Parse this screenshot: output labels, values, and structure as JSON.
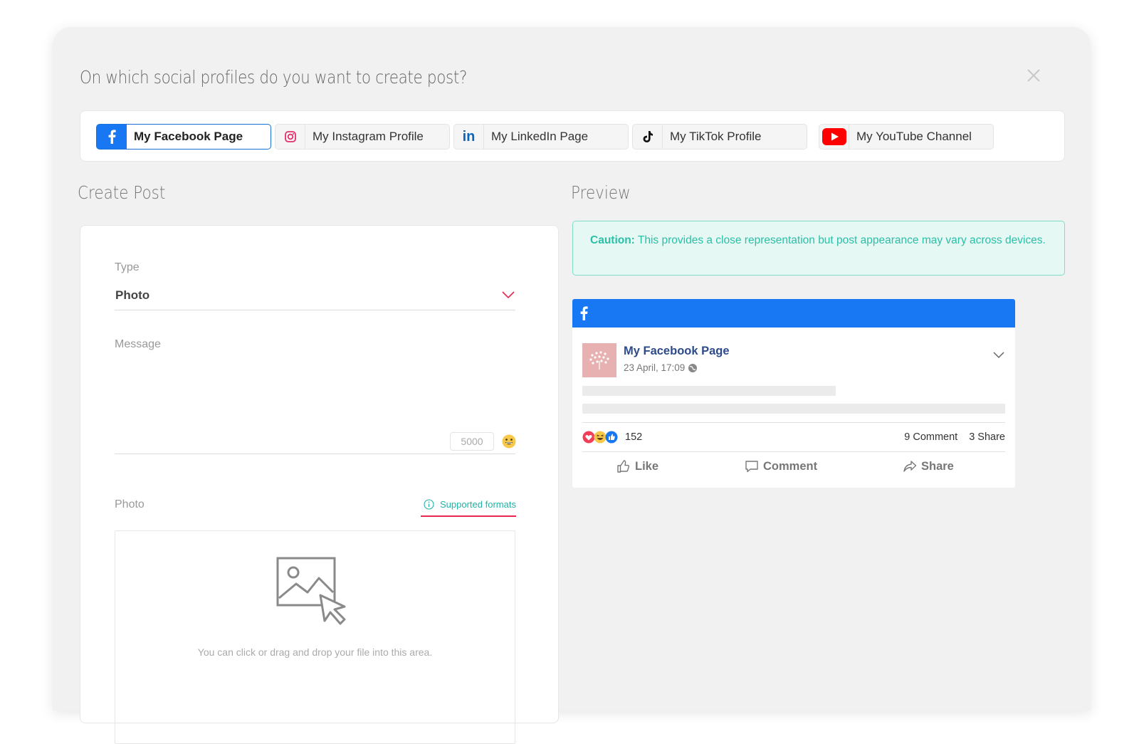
{
  "modal": {
    "title": "On which social profiles do you want to create post?"
  },
  "profiles": [
    {
      "label": "My Facebook Page",
      "icon": "facebook-icon",
      "active": true
    },
    {
      "label": "My Instagram Profile",
      "icon": "instagram-icon",
      "active": false
    },
    {
      "label": "My LinkedIn Page",
      "icon": "linkedin-icon",
      "active": false
    },
    {
      "label": "My TikTok Profile",
      "icon": "tiktok-icon",
      "active": false
    },
    {
      "label": "My YouTube Channel",
      "icon": "youtube-icon",
      "active": false
    }
  ],
  "create_post": {
    "title": "Create Post",
    "type_label": "Type",
    "type_value": "Photo",
    "message_label": "Message",
    "char_limit": "5000",
    "photo_label": "Photo",
    "supported_formats": "Supported formats",
    "drop_text": "You can click or drag and drop your file into this area."
  },
  "preview": {
    "title": "Preview",
    "caution_label": "Caution:",
    "caution_text": "This provides a close representation but post appearance may vary across devices.",
    "fb": {
      "page_name": "My Facebook Page",
      "date": "23 April, 17:09",
      "reaction_count": "152",
      "comments": "9 Comment",
      "shares": "3 Share",
      "like_label": "Like",
      "comment_label": "Comment",
      "share_label": "Share"
    }
  },
  "colors": {
    "facebook": "#1877f2",
    "accent_teal": "#20b2a6",
    "highlight_red": "#e8264f"
  }
}
